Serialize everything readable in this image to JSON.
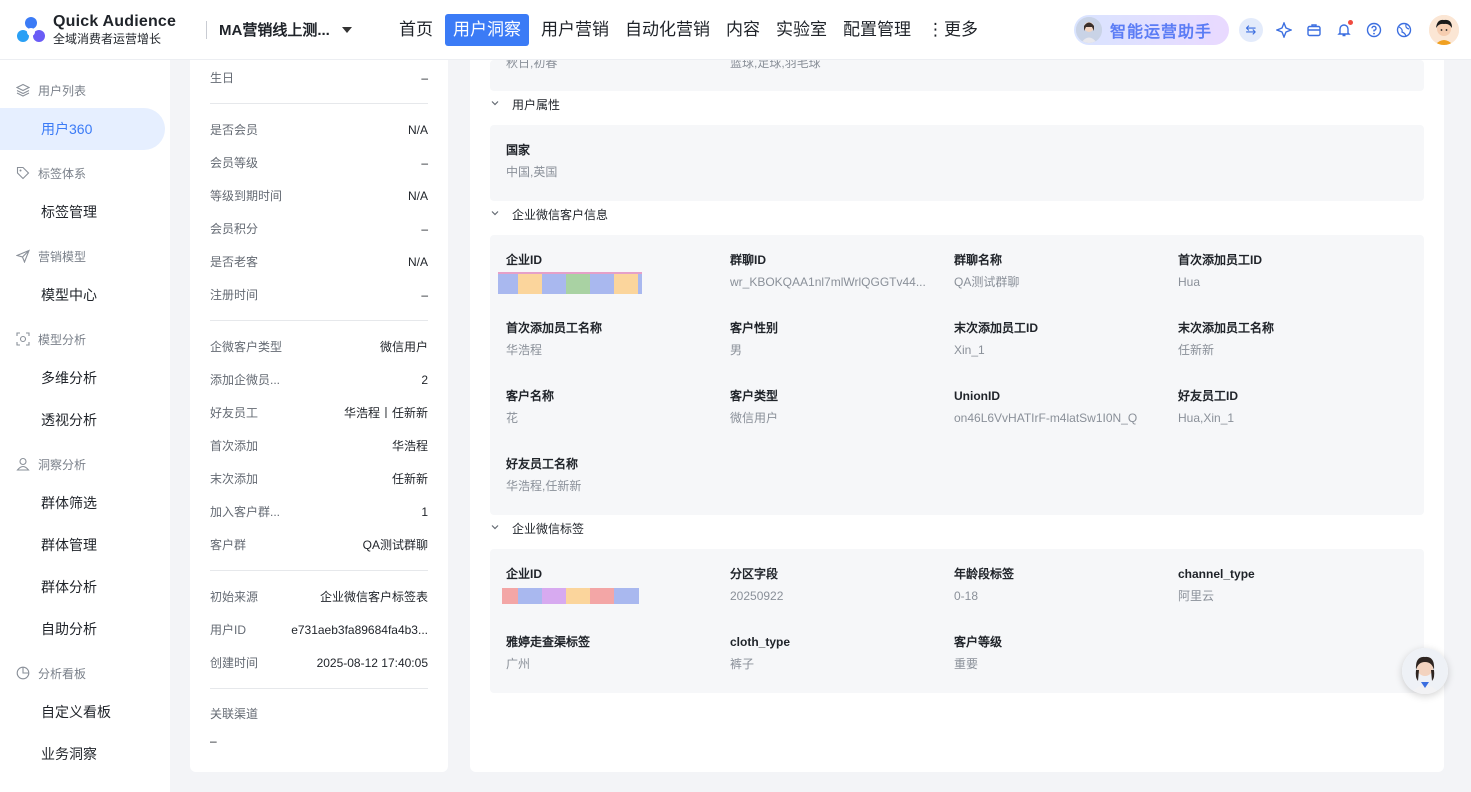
{
  "app": {
    "name": "Quick Audience",
    "subtitle": "全域消费者运营增长"
  },
  "project": {
    "name": "MA营销线上测..."
  },
  "nav": [
    "首页",
    "用户洞察",
    "用户营销",
    "自动化营销",
    "内容",
    "实验室",
    "配置管理",
    "⋮更多"
  ],
  "nav_active": "用户洞察",
  "assistant": {
    "label": "智能运营助手"
  },
  "sidebar": {
    "groups": [
      {
        "label": "用户列表",
        "icon": "layers-icon",
        "items": [
          "用户360"
        ]
      },
      {
        "label": "标签体系",
        "icon": "tag-icon",
        "items": [
          "标签管理"
        ]
      },
      {
        "label": "营销模型",
        "icon": "send-icon",
        "items": [
          "模型中心"
        ]
      },
      {
        "label": "模型分析",
        "icon": "scan-icon",
        "items": [
          "多维分析",
          "透视分析"
        ]
      },
      {
        "label": "洞察分析",
        "icon": "users-icon",
        "items": [
          "群体筛选",
          "群体管理",
          "群体分析",
          "自助分析"
        ]
      },
      {
        "label": "分析看板",
        "icon": "pie-icon",
        "items": [
          "自定义看板",
          "业务洞察"
        ]
      }
    ],
    "active": "用户360"
  },
  "profile": {
    "birthday": {
      "label": "生日",
      "value": "–"
    },
    "member": [
      {
        "label": "是否会员",
        "value": "N/A"
      },
      {
        "label": "会员等级",
        "value": "–"
      },
      {
        "label": "等级到期时间",
        "value": "N/A"
      },
      {
        "label": "会员积分",
        "value": "–"
      },
      {
        "label": "是否老客",
        "value": "N/A"
      },
      {
        "label": "注册时间",
        "value": "–"
      }
    ],
    "wecom": [
      {
        "label": "企微客户类型",
        "value": "微信用户"
      },
      {
        "label": "添加企微员...",
        "value": "2"
      },
      {
        "label": "好友员工",
        "value": "华浩程丨任新新"
      },
      {
        "label": "首次添加",
        "value": "华浩程"
      },
      {
        "label": "末次添加",
        "value": "任新新"
      },
      {
        "label": "加入客户群...",
        "value": "1"
      },
      {
        "label": "客户群",
        "value": "QA测试群聊"
      }
    ],
    "source": [
      {
        "label": "初始来源",
        "value": "企业微信客户标签表"
      },
      {
        "label": "用户ID",
        "value": "e731aeb3fa89684fa4b3..."
      },
      {
        "label": "创建时间",
        "value": "2025-08-12 17:40:05"
      }
    ],
    "channel": {
      "label": "关联渠道",
      "value": "–"
    }
  },
  "main": {
    "top_partial": [
      "秋日,初春",
      "篮球,足球,羽毛球"
    ],
    "sections": [
      {
        "title": "用户属性",
        "fields": [
          {
            "label": "国家",
            "value": "中国,英国"
          }
        ]
      },
      {
        "title": "企业微信客户信息",
        "fields": [
          {
            "label": "企业ID",
            "value": ""
          },
          {
            "label": "群聊ID",
            "value": "wr_KBOKQAA1nl7mlWrlQGGTv44..."
          },
          {
            "label": "群聊名称",
            "value": "QA测试群聊"
          },
          {
            "label": "首次添加员工ID",
            "value": "Hua"
          },
          {
            "label": "首次添加员工名称",
            "value": "华浩程"
          },
          {
            "label": "客户性别",
            "value": "男"
          },
          {
            "label": "末次添加员工ID",
            "value": "Xin_1"
          },
          {
            "label": "末次添加员工名称",
            "value": "任新新"
          },
          {
            "label": "客户名称",
            "value": "花"
          },
          {
            "label": "客户类型",
            "value": "微信用户"
          },
          {
            "label": "UnionID",
            "value": "on46L6VvHATIrF-m4latSw1I0N_Q"
          },
          {
            "label": "好友员工ID",
            "value": "Hua,Xin_1"
          },
          {
            "label": "好友员工名称",
            "value": "华浩程,任新新"
          }
        ]
      },
      {
        "title": "企业微信标签",
        "fields": [
          {
            "label": "企业ID",
            "value": ""
          },
          {
            "label": "分区字段",
            "value": "20250922"
          },
          {
            "label": "年龄段标签",
            "value": "0-18"
          },
          {
            "label": "channel_type",
            "value": "阿里云"
          },
          {
            "label": "雅婷走查渠标签",
            "value": "广州"
          },
          {
            "label": "cloth_type",
            "value": "裤子"
          },
          {
            "label": "客户等级",
            "value": "重要"
          }
        ]
      }
    ]
  },
  "colors": {
    "accent": "#3b7bf6",
    "active_bg": "#e6efff"
  }
}
